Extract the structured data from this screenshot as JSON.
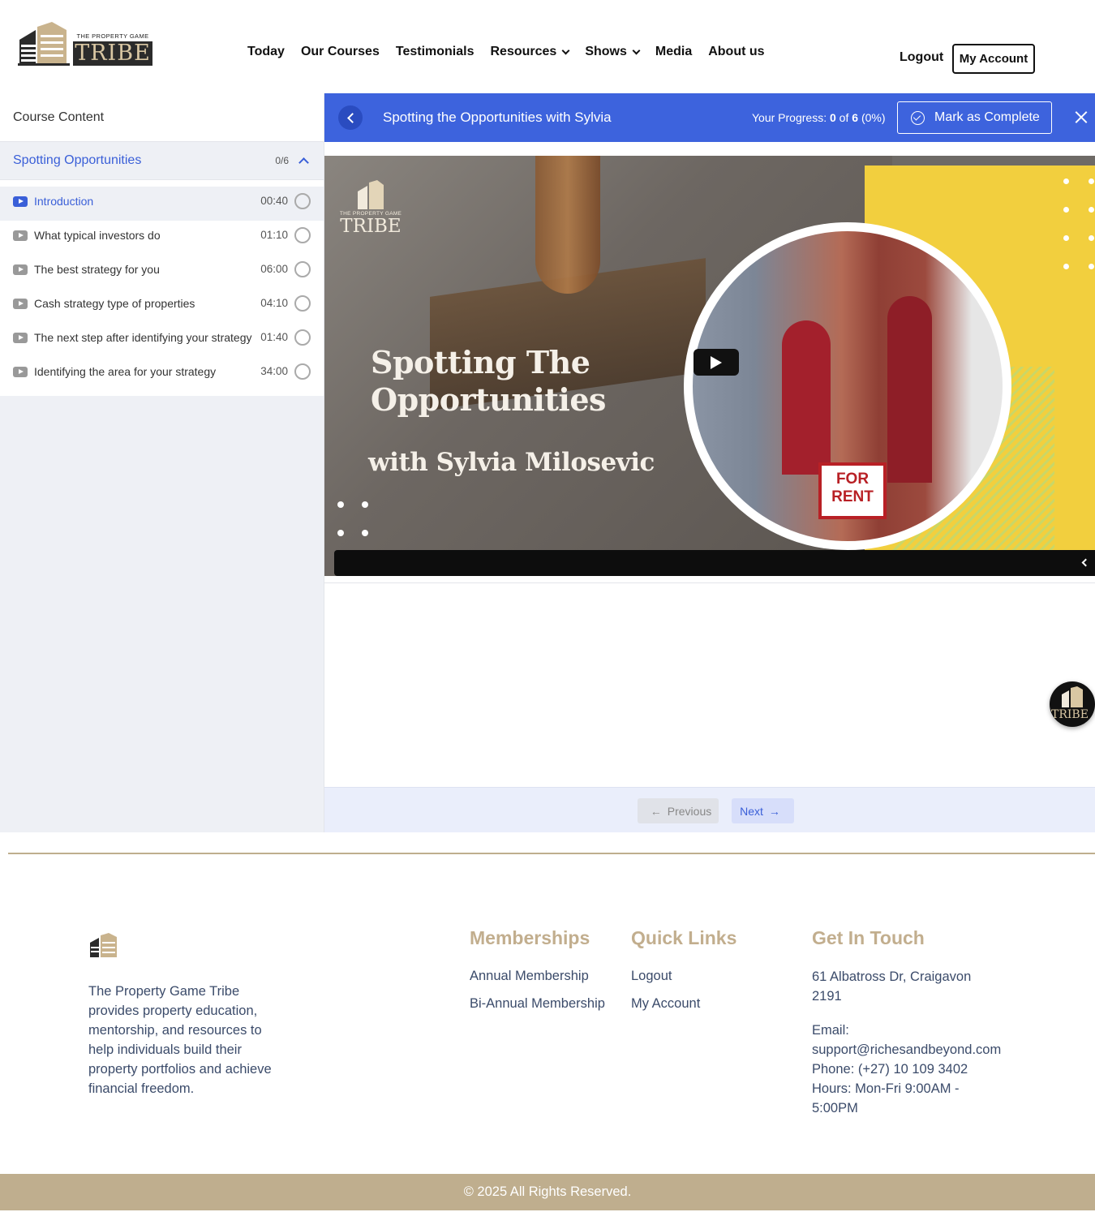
{
  "header": {
    "logo_small": "THE PROPERTY GAME",
    "logo_big": "TRIBE",
    "nav": [
      {
        "label": "Today",
        "dropdown": false
      },
      {
        "label": "Our Courses",
        "dropdown": false
      },
      {
        "label": "Testimonials",
        "dropdown": false
      },
      {
        "label": "Resources",
        "dropdown": true
      },
      {
        "label": "Shows",
        "dropdown": true
      },
      {
        "label": "Media",
        "dropdown": false
      },
      {
        "label": "About us",
        "dropdown": false
      }
    ],
    "logout": "Logout",
    "my_account": "My Account"
  },
  "sidebar": {
    "title": "Course Content",
    "topic": {
      "name": "Spotting Opportunities",
      "count": "0/6"
    },
    "lessons": [
      {
        "title": "Introduction",
        "duration": "00:40",
        "active": true
      },
      {
        "title": "What typical investors do",
        "duration": "01:10",
        "active": false
      },
      {
        "title": "The best strategy for you",
        "duration": "06:00",
        "active": false
      },
      {
        "title": "Cash strategy type of properties",
        "duration": "04:10",
        "active": false
      },
      {
        "title": "The next step after identifying your strategy",
        "duration": "01:40",
        "active": false
      },
      {
        "title": "Identifying the area for your strategy",
        "duration": "34:00",
        "active": false
      }
    ]
  },
  "topbar": {
    "course_title": "Spotting the Opportunities with Sylvia",
    "progress_label": "Your Progress:",
    "progress_done": "0",
    "progress_of": "of",
    "progress_total": "6",
    "progress_pct": "(0%)",
    "mark_complete": "Mark as Complete"
  },
  "video": {
    "logo_small": "THE PROPERTY GAME",
    "logo_big": "TRIBE",
    "title_line1": "Spotting The",
    "title_line2": "Opportunities",
    "subtitle": "with Sylvia Milosevic",
    "sign_line1": "FOR",
    "sign_line2": "RENT"
  },
  "floating_logo": "TRIBE",
  "pager": {
    "previous": "Previous",
    "next": "Next"
  },
  "footer": {
    "description": "The Property Game Tribe provides property education, mentorship, and resources to help individuals build their property portfolios and achieve financial freedom.",
    "memberships_heading": "Memberships",
    "memberships": [
      "Annual Membership",
      "Bi-Annual Membership"
    ],
    "quick_links_heading": "Quick Links",
    "quick_links": [
      "Logout",
      "My Account"
    ],
    "contact_heading": "Get In Touch",
    "address": "61 Albatross Dr, Craigavon 2191",
    "email_label": "Email:",
    "email": "support@richesandbeyond.com",
    "phone": "Phone: (+27) 10 109 3402",
    "hours": "Hours: Mon-Fri 9:00AM - 5:00PM",
    "copyright": "© 2025 All Rights Reserved."
  },
  "colors": {
    "accent": "#3d63dd",
    "brand_tan": "#bfae8e",
    "footer_text": "#3b4b6a"
  }
}
